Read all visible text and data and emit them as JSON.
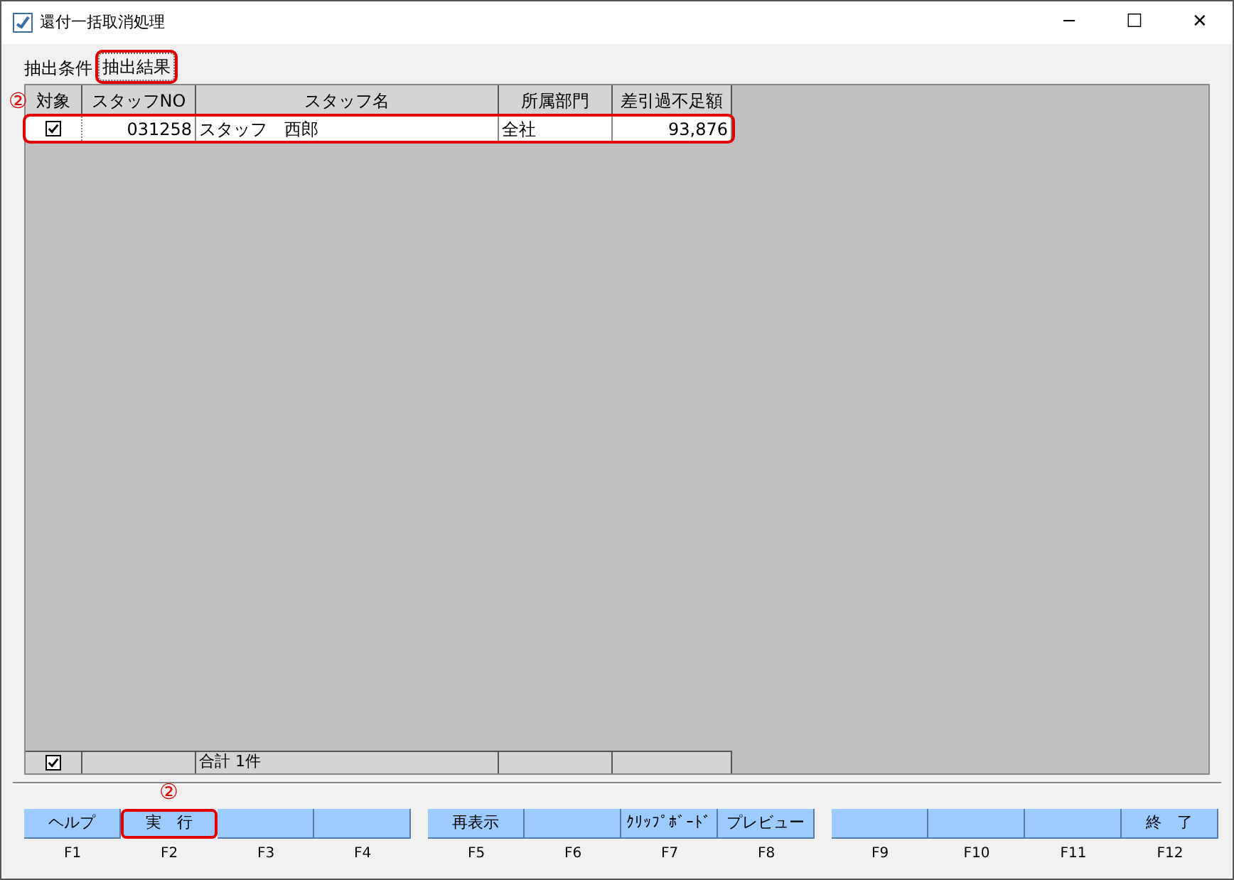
{
  "window": {
    "title": "還付一括取消処理",
    "buttons": [
      "─",
      "☐",
      "✕"
    ]
  },
  "tabs": [
    {
      "label": "抽出条件",
      "selected": false,
      "highlighted": false
    },
    {
      "label": "抽出結果",
      "selected": true,
      "highlighted": true
    }
  ],
  "table": {
    "checkbox_column": "対象",
    "columns": [
      "スタッフNO",
      "スタッフ名",
      "所属部門",
      "差引過不足額"
    ],
    "rows": [
      {
        "checked": true,
        "highlighted": true,
        "cells": [
          "031258",
          "スタッフ　西郎",
          "全社",
          "93,876"
        ]
      }
    ],
    "footer": {
      "checked": true,
      "label": "合計 1件"
    }
  },
  "annotations": [
    {
      "label": "②"
    },
    {
      "label": "②"
    }
  ],
  "function_keys": [
    {
      "label": "ヘルプ",
      "key": "F1",
      "highlighted": false
    },
    {
      "label": "実　行",
      "key": "F2",
      "highlighted": true
    },
    {
      "key": "F3",
      "highlighted": false
    },
    {
      "key": "F4",
      "highlighted": false
    },
    {
      "label": "再表示",
      "key": "F5",
      "highlighted": false
    },
    {
      "key": "F6",
      "highlighted": false
    },
    {
      "label": "ｸﾘｯﾌﾟﾎﾞｰﾄﾞ",
      "key": "F7",
      "highlighted": false
    },
    {
      "label": "プレビュー",
      "key": "F8",
      "highlighted": false
    },
    {
      "key": "F9",
      "highlighted": false
    },
    {
      "key": "F10",
      "highlighted": false
    },
    {
      "key": "F11",
      "highlighted": false
    },
    {
      "label": "終　了",
      "key": "F12",
      "highlighted": false
    }
  ]
}
